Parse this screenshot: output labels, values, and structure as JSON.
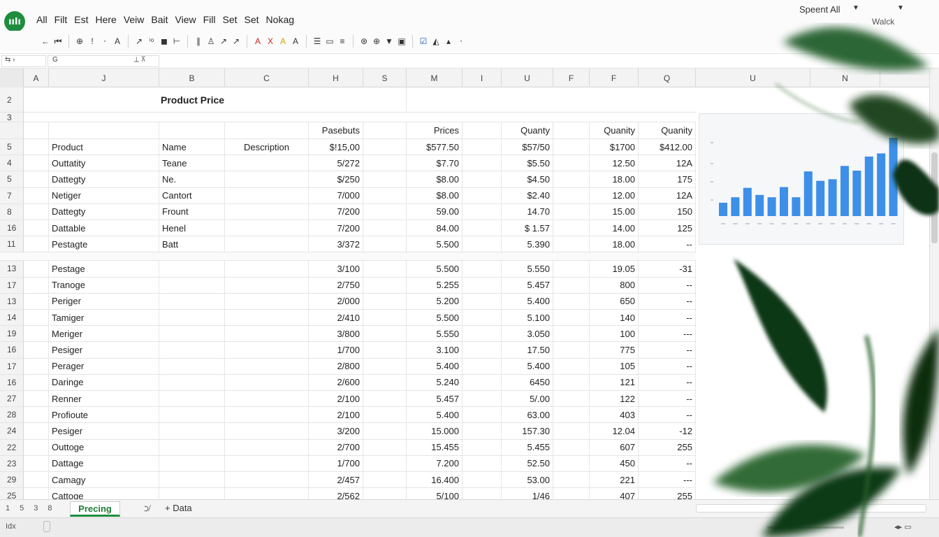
{
  "app": {
    "logo_text": "ıılı"
  },
  "menu": [
    "All",
    "Filt",
    "Est",
    "Here",
    "Veiw",
    "Bait",
    "View",
    "Fill",
    "Set",
    "Set",
    "Nokag"
  ],
  "top_right": {
    "account_label": "Speent  All",
    "user_label": "Walck"
  },
  "toolbar": {
    "icons": [
      "←",
      "⏮",
      "⊕",
      "!",
      "⋅",
      "A",
      "↗",
      "ⁱᵒ",
      "◼",
      "⊢",
      "∥",
      "♙",
      "↗",
      "↗",
      "A",
      "X",
      "A",
      "A",
      "☰",
      "▭",
      "≡",
      "⊛",
      "⊕",
      "▼",
      "▣",
      "☑",
      "◭",
      "▴",
      "⋅"
    ]
  },
  "formula_bar": {
    "name_box": "⇆  ›",
    "fx": "G"
  },
  "columns": [
    "A",
    "J",
    "B",
    "C",
    "H",
    "S",
    "M",
    "I",
    "U",
    "F",
    "F",
    "Q",
    "U",
    "N"
  ],
  "sheet_title": "Product Price",
  "header_row": {
    "row_num": "3",
    "c1": "Pasebuts",
    "c2": "Prices",
    "c3": "Quanty",
    "c4": "Quanity",
    "c5": "Quanity"
  },
  "rows": [
    {
      "num": "5",
      "a": "Product",
      "b": "Name",
      "c": "Description",
      "h": "$!15,00",
      "m": "$577.50",
      "u": "$57/50",
      "f": "$1700",
      "q": "$412.00"
    },
    {
      "num": "4",
      "a": "Outtatity",
      "b": "Teane",
      "c": "",
      "h": "5/272",
      "m": "$7.70",
      "u": "$5.50",
      "f": "12.50",
      "q": "12A"
    },
    {
      "num": "5",
      "a": "Dattegty",
      "b": "Ne.",
      "c": "",
      "h": "$/250",
      "m": "$8.00",
      "u": "$4.50",
      "f": "18.00",
      "q": "175"
    },
    {
      "num": "7",
      "a": "Netiger",
      "b": "Cantort",
      "c": "",
      "h": "7/000",
      "m": "$8.00",
      "u": "$2.40",
      "f": "12.00",
      "q": "12A"
    },
    {
      "num": "8",
      "a": "Dattegty",
      "b": "Frount",
      "c": "",
      "h": "7/200",
      "m": "59.00",
      "u": "14.70",
      "f": "15.00",
      "q": "150"
    },
    {
      "num": "16",
      "a": "Dattable",
      "b": "Henel",
      "c": "",
      "h": "7/200",
      "m": "84.00",
      "u": "$ 1.57",
      "f": "14.00",
      "q": "125"
    },
    {
      "num": "11",
      "a": "Pestagte",
      "b": "Batt",
      "c": "",
      "h": "3/372",
      "m": "5.500",
      "u": "5.390",
      "f": "18.00",
      "q": "--"
    },
    {
      "num": "13",
      "a": "Pestage",
      "b": "",
      "c": "",
      "h": "3/100",
      "m": "5.500",
      "u": "5.550",
      "f": "19.05",
      "q": "-31"
    },
    {
      "num": "17",
      "a": "Tranoge",
      "b": "",
      "c": "",
      "h": "2/750",
      "m": "5.255",
      "u": "5.457",
      "f": "800",
      "q": "--"
    },
    {
      "num": "13",
      "a": "Periger",
      "b": "",
      "c": "",
      "h": "2/000",
      "m": "5.200",
      "u": "5.400",
      "f": "650",
      "q": "--"
    },
    {
      "num": "14",
      "a": "Tamiger",
      "b": "",
      "c": "",
      "h": "2/410",
      "m": "5.500",
      "u": "5.100",
      "f": "140",
      "q": "--"
    },
    {
      "num": "19",
      "a": "Meriger",
      "b": "",
      "c": "",
      "h": "3/800",
      "m": "5.550",
      "u": "3.050",
      "f": "100",
      "q": "---"
    },
    {
      "num": "16",
      "a": "Pesiger",
      "b": "",
      "c": "",
      "h": "1/700",
      "m": "3.100",
      "u": "17.50",
      "f": "775",
      "q": "--"
    },
    {
      "num": "17",
      "a": "Perager",
      "b": "",
      "c": "",
      "h": "2/800",
      "m": "5.400",
      "u": "5.400",
      "f": "105",
      "q": "--"
    },
    {
      "num": "16",
      "a": "Daringe",
      "b": "",
      "c": "",
      "h": "2/600",
      "m": "5.240",
      "u": "6450",
      "f": "121",
      "q": "--"
    },
    {
      "num": "27",
      "a": "Renner",
      "b": "",
      "c": "",
      "h": "2/100",
      "m": "5.457",
      "u": "5/.00",
      "f": "122",
      "q": "--"
    },
    {
      "num": "28",
      "a": "Profioute",
      "b": "",
      "c": "",
      "h": "2/100",
      "m": "5.400",
      "u": "63.00",
      "f": "403",
      "q": "--"
    },
    {
      "num": "24",
      "a": "Pesiger",
      "b": "",
      "c": "",
      "h": "3/200",
      "m": "15.000",
      "u": "157.30",
      "f": "12.04",
      "q": "-12"
    },
    {
      "num": "22",
      "a": "Outtoge",
      "b": "",
      "c": "",
      "h": "2/700",
      "m": "15.455",
      "u": "5.455",
      "f": "607",
      "q": "255"
    },
    {
      "num": "23",
      "a": "Dattage",
      "b": "",
      "c": "",
      "h": "1/700",
      "m": "7.200",
      "u": "52.50",
      "f": "450",
      "q": "--"
    },
    {
      "num": "29",
      "a": "Camagy",
      "b": "",
      "c": "",
      "h": "2/457",
      "m": "16.400",
      "u": "53.00",
      "f": "221",
      "q": "---"
    },
    {
      "num": "25",
      "a": "Cattoge",
      "b": "",
      "c": "",
      "h": "2/562",
      "m": "5/100",
      "u": "1/46",
      "f": "407",
      "q": "255"
    }
  ],
  "first_row_nums": [
    "2",
    "3"
  ],
  "chart_data": {
    "type": "bar",
    "color": "#3d8fe8",
    "values": [
      0.17,
      0.24,
      0.36,
      0.27,
      0.24,
      0.37,
      0.24,
      0.57,
      0.45,
      0.47,
      0.64,
      0.58,
      0.76,
      0.8,
      1.0
    ],
    "ylim": [
      0,
      1
    ],
    "grid": false
  },
  "tabs": {
    "nav": [
      "1",
      "5",
      "3",
      "8"
    ],
    "active": "Precing",
    "add_label": "+  Data"
  },
  "status": {
    "left": "Idx"
  },
  "colors": {
    "accent": "#1e8e3e",
    "bar": "#3d8fe8",
    "plant_dark": "#0f3d1a",
    "plant_mid": "#2c6e2f"
  }
}
